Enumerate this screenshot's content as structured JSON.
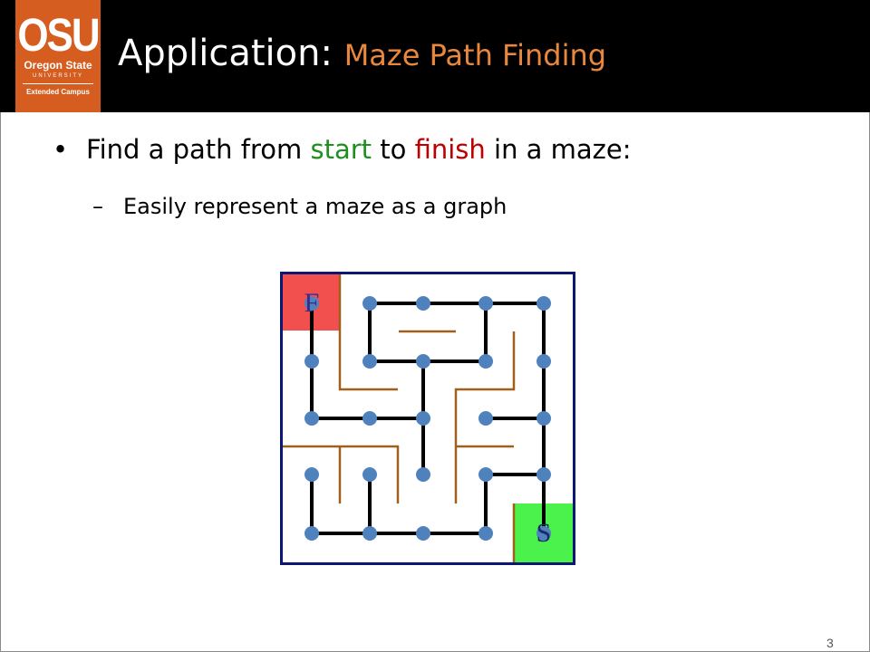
{
  "logo": {
    "main": "OSU",
    "line1": "Oregon State",
    "line2": "UNIVERSITY",
    "line3": "Extended Campus"
  },
  "title": {
    "main": "Application: ",
    "sub": "Maze Path Finding"
  },
  "bullet": {
    "marker": "•",
    "prefix": "Find a path from ",
    "start_word": "start",
    "middle": " to ",
    "finish_word": "finish",
    "suffix": " in a maze:"
  },
  "sub_bullet": {
    "marker": "–",
    "text": "Easily represent a maze as a graph"
  },
  "maze": {
    "finish_label": "F",
    "start_label": "S",
    "colors": {
      "border": "#0d1670",
      "walls": "#a0601c",
      "edges": "#000000",
      "nodes": "#4f81bd",
      "finish_cell": "#f24f4f",
      "start_cell": "#4cf24c"
    }
  },
  "page_number": "3"
}
